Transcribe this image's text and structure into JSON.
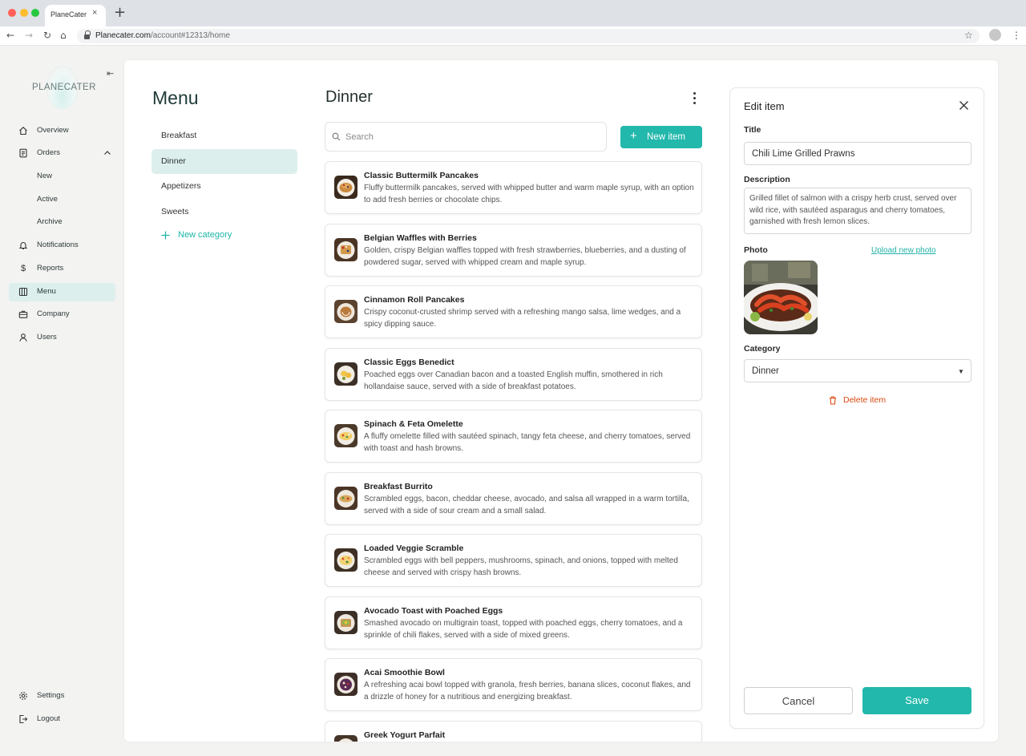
{
  "browser": {
    "tab_title": "PlaneCater",
    "tab_close": "×",
    "new_tab": "+",
    "url_host": "Planecater.com",
    "url_path": "/account#12313/home"
  },
  "sidebar": {
    "logo_text": "PLANECATER",
    "items": [
      {
        "label": "Overview",
        "icon": "home-icon"
      },
      {
        "label": "Orders",
        "icon": "orders-icon"
      },
      {
        "label": "New"
      },
      {
        "label": "Active"
      },
      {
        "label": "Archive"
      },
      {
        "label": "Notifications",
        "icon": "bell-icon"
      },
      {
        "label": "Reports",
        "icon": "dollar-icon"
      },
      {
        "label": "Menu",
        "icon": "menu-book-icon",
        "active": true
      },
      {
        "label": "Company",
        "icon": "briefcase-icon"
      },
      {
        "label": "Users",
        "icon": "user-icon"
      }
    ],
    "bottom": [
      {
        "label": "Settings",
        "icon": "gear-icon"
      },
      {
        "label": "Logout",
        "icon": "logout-icon"
      }
    ]
  },
  "menu": {
    "title": "Menu",
    "categories": [
      "Breakfast",
      "Dinner",
      "Appetizers",
      "Sweets"
    ],
    "active_category": "Dinner",
    "new_category_label": "New category"
  },
  "dinner": {
    "title": "Dinner",
    "search_placeholder": "Search",
    "new_item_label": "New item",
    "items": [
      {
        "title": "Classic Buttermilk Pancakes",
        "desc": "Fluffy buttermilk pancakes, served with whipped butter and warm maple syrup, with an option to add fresh berries or chocolate chips."
      },
      {
        "title": "Belgian Waffles with Berries",
        "desc": "Golden, crispy Belgian waffles topped with fresh strawberries, blueberries, and a dusting of powdered sugar, served with whipped cream and maple syrup."
      },
      {
        "title": "Cinnamon Roll Pancakes",
        "desc": "Crispy coconut-crusted shrimp served with a refreshing mango salsa, lime wedges, and a spicy dipping sauce."
      },
      {
        "title": "Classic Eggs Benedict",
        "desc": "Poached eggs over Canadian bacon and a toasted English muffin, smothered in rich hollandaise sauce, served with a side of breakfast potatoes."
      },
      {
        "title": "Spinach & Feta Omelette",
        "desc": "A fluffy omelette filled with sautéed spinach, tangy feta cheese, and cherry tomatoes, served with toast and hash browns."
      },
      {
        "title": "Breakfast Burrito",
        "desc": "Scrambled eggs, bacon, cheddar cheese, avocado, and salsa all wrapped in a warm tortilla, served with a side of sour cream and a small salad."
      },
      {
        "title": "Loaded Veggie Scramble",
        "desc": "Scrambled eggs with bell peppers, mushrooms, spinach, and onions, topped with melted cheese and served with crispy hash browns."
      },
      {
        "title": "Avocado Toast with Poached Eggs",
        "desc": "Smashed avocado on multigrain toast, topped with poached eggs, cherry tomatoes, and a sprinkle of chili flakes, served with a side of mixed greens."
      },
      {
        "title": "Acai Smoothie Bowl",
        "desc": "A refreshing acai bowl topped with granola, fresh berries, banana slices, coconut flakes, and a drizzle of honey for a nutritious and energizing breakfast."
      },
      {
        "title": "Greek Yogurt Parfait",
        "desc": ""
      }
    ]
  },
  "edit": {
    "heading": "Edit item",
    "title_label": "Title",
    "title_value": "Chili Lime Grilled Prawns",
    "description_label": "Description",
    "description_value": "Grilled fillet of salmon with a crispy herb crust, served over wild rice, with sautéed asparagus and cherry tomatoes, garnished with fresh lemon slices.",
    "photo_label": "Photo",
    "upload_label": "Upload new photo",
    "category_label": "Category",
    "category_value": "Dinner",
    "delete_label": "Delete item",
    "cancel_label": "Cancel",
    "save_label": "Save"
  },
  "colors": {
    "accent": "#22b8ab",
    "active_bg": "#dcefed",
    "danger": "#d9480f"
  }
}
